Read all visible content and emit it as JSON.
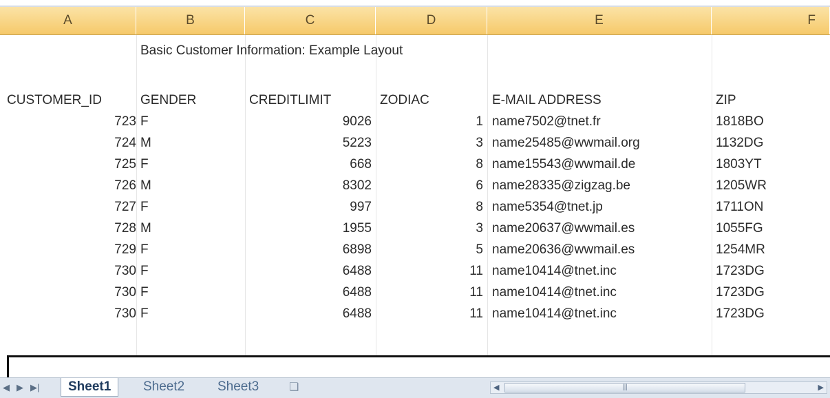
{
  "columns": [
    "A",
    "B",
    "C",
    "D",
    "E",
    "F"
  ],
  "sheet_title": "Basic Customer Information: Example Layout",
  "headers": [
    "CUSTOMER_ID",
    "GENDER",
    "CREDITLIMIT",
    "ZODIAC",
    "E-MAIL ADDRESS",
    "ZIP"
  ],
  "rows": [
    {
      "id": "723",
      "gender": "F",
      "credit": "9026",
      "zodiac": "1",
      "email": "name7502@tnet.fr",
      "zip": "1818BO"
    },
    {
      "id": "724",
      "gender": "M",
      "credit": "5223",
      "zodiac": "3",
      "email": "name25485@wwmail.org",
      "zip": "1132DG"
    },
    {
      "id": "725",
      "gender": "F",
      "credit": "668",
      "zodiac": "8",
      "email": "name15543@wwmail.de",
      "zip": "1803YT"
    },
    {
      "id": "726",
      "gender": "M",
      "credit": "8302",
      "zodiac": "6",
      "email": "name28335@zigzag.be",
      "zip": "1205WR"
    },
    {
      "id": "727",
      "gender": "F",
      "credit": "997",
      "zodiac": "8",
      "email": "name5354@tnet.jp",
      "zip": "1711ON"
    },
    {
      "id": "728",
      "gender": "M",
      "credit": "1955",
      "zodiac": "3",
      "email": "name20637@wwmail.es",
      "zip": "1055FG"
    },
    {
      "id": "729",
      "gender": "F",
      "credit": "6898",
      "zodiac": "5",
      "email": "name20636@wwmail.es",
      "zip": "1254MR"
    },
    {
      "id": "730",
      "gender": "F",
      "credit": "6488",
      "zodiac": "11",
      "email": "name10414@tnet.inc",
      "zip": "1723DG"
    },
    {
      "id": "730",
      "gender": "F",
      "credit": "6488",
      "zodiac": "11",
      "email": "name10414@tnet.inc",
      "zip": "1723DG"
    },
    {
      "id": "730",
      "gender": "F",
      "credit": "6488",
      "zodiac": "11",
      "email": "name10414@tnet.inc",
      "zip": "1723DG"
    }
  ],
  "sheet_tabs": [
    "Sheet1",
    "Sheet2",
    "Sheet3"
  ],
  "active_tab": "Sheet1",
  "icons": {
    "nav_first": "first-sheet-icon",
    "nav_prev": "prev-sheet-icon",
    "nav_next": "next-sheet-icon",
    "nav_last": "last-sheet-icon",
    "insert_sheet": "insert-sheet-icon"
  },
  "colors": {
    "header_bg": "#f6c96a",
    "tab_bar": "#dfe6ef",
    "active_tab_text": "#1f3b5e"
  }
}
